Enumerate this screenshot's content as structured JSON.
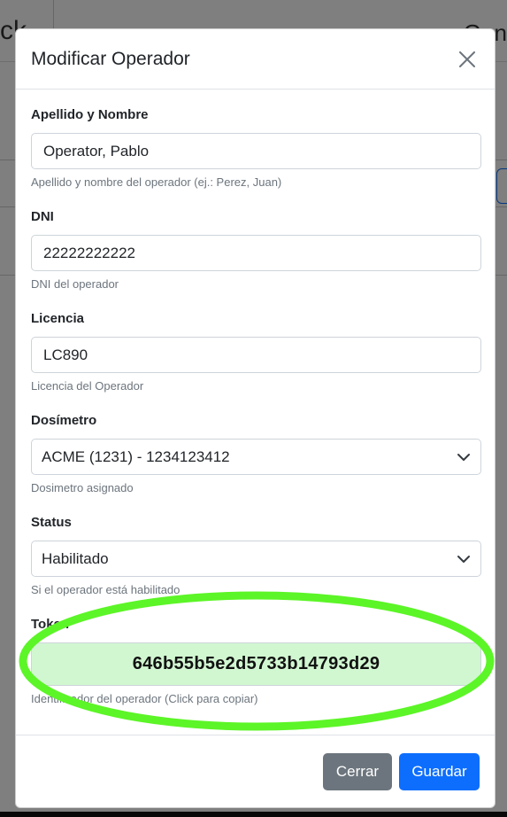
{
  "background": {
    "left_fragment": "ck",
    "right_fragment": "Gen"
  },
  "modal": {
    "title": "Modificar Operador",
    "fields": {
      "nombre": {
        "label": "Apellido y Nombre",
        "value": "Operator, Pablo",
        "help": "Apellido y nombre del operador (ej.: Perez, Juan)"
      },
      "dni": {
        "label": "DNI",
        "value": "22222222222",
        "help": "DNI del operador"
      },
      "licencia": {
        "label": "Licencia",
        "value": "LC890",
        "help": "Licencia del Operador"
      },
      "dosimetro": {
        "label": "Dosímetro",
        "value": "ACME (1231) - 1234123412",
        "help": "Dosimetro asignado"
      },
      "status": {
        "label": "Status",
        "value": "Habilitado",
        "help": "Si el operador está habilitado"
      },
      "token": {
        "label": "Token",
        "value": "646b55b5e2d5733b14793d29",
        "help": "Identificador del operador (Click para copiar)"
      }
    },
    "footer": {
      "cerrar_label": "Cerrar",
      "guardar_label": "Guardar"
    }
  },
  "colors": {
    "primary": "#0d6efd",
    "secondary": "#6c757d",
    "token_bg": "#d1f7d1",
    "annotation": "#5cf527"
  },
  "icons": {
    "close": "close-icon",
    "select_arrow": "chevron-down-icon"
  }
}
